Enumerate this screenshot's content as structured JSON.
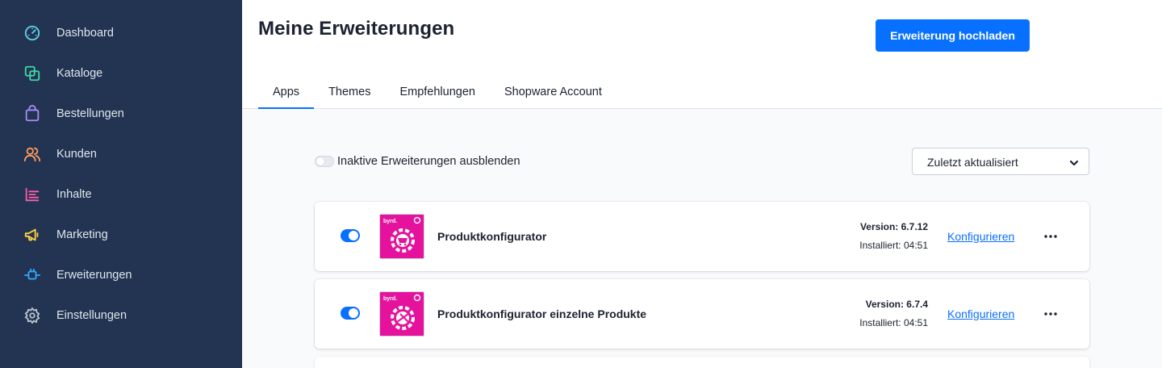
{
  "sidebar": {
    "items": [
      {
        "label": "Dashboard",
        "icon": "gauge-icon",
        "color": "#5fd0e8"
      },
      {
        "label": "Kataloge",
        "icon": "catalog-icon",
        "color": "#3fd7a6"
      },
      {
        "label": "Bestellungen",
        "icon": "shopping-bag-icon",
        "color": "#a88bf8"
      },
      {
        "label": "Kunden",
        "icon": "users-icon",
        "color": "#ff9a5b"
      },
      {
        "label": "Inhalte",
        "icon": "content-icon",
        "color": "#ff5ba8"
      },
      {
        "label": "Marketing",
        "icon": "megaphone-icon",
        "color": "#ffd23f"
      },
      {
        "label": "Erweiterungen",
        "icon": "plug-icon",
        "color": "#33a6ff"
      },
      {
        "label": "Einstellungen",
        "icon": "gear-icon",
        "color": "#b9c3d1"
      }
    ]
  },
  "header": {
    "title": "Meine Erweiterungen",
    "upload_label": "Erweiterung hochladen",
    "tabs": [
      "Apps",
      "Themes",
      "Empfehlungen",
      "Shopware Account"
    ],
    "active_tab": "Apps"
  },
  "filter": {
    "hide_inactive_label": "Inaktive Erweiterungen ausblenden",
    "hide_inactive_enabled": false,
    "sort_value": "Zuletzt aktualisiert"
  },
  "extensions": [
    {
      "name": "Produktkonfigurator",
      "version": "Version: 6.7.12",
      "installed": "Installiert: 04:51",
      "active": true,
      "action": "Konfigurieren"
    },
    {
      "name": "Produktkonfigurator einzelne Produkte",
      "version": "Version: 6.7.4",
      "installed": "Installiert: 04:51",
      "active": true,
      "action": "Konfigurieren"
    }
  ],
  "colors": {
    "sidebar_bg": "#223451",
    "accent": "#0870ff",
    "logo_bg": "#e4129c"
  }
}
